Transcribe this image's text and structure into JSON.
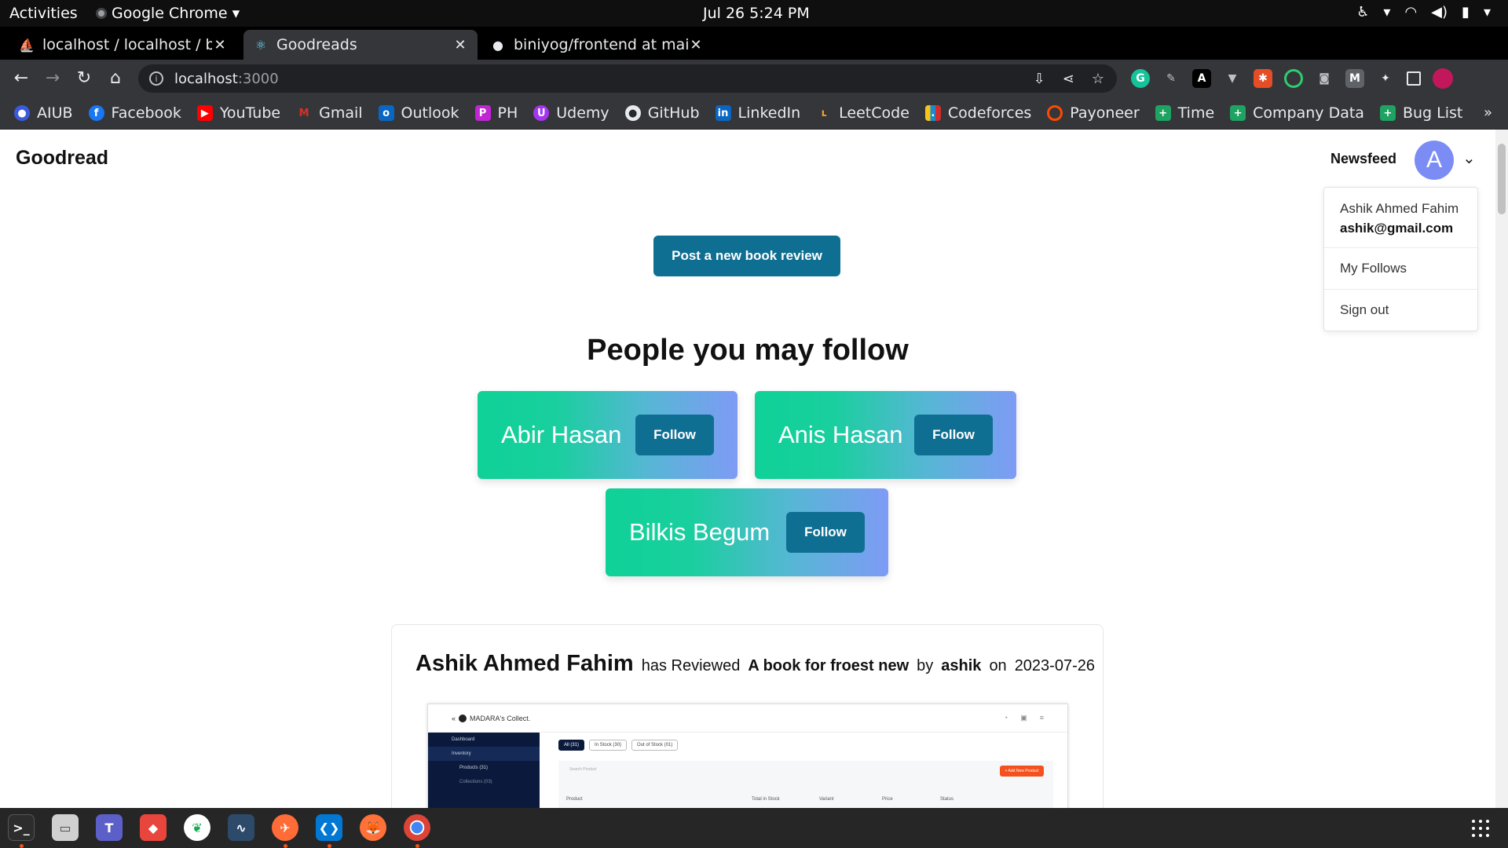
{
  "system": {
    "activities": "Activities",
    "app_name": "Google Chrome",
    "clock": "Jul 26  5:24 PM"
  },
  "browser": {
    "tabs": [
      {
        "title": "localhost / localhost / bini",
        "icon": "phpmyadmin-icon"
      },
      {
        "title": "Goodreads",
        "icon": "react-icon",
        "active": true
      },
      {
        "title": "biniyog/frontend at main",
        "icon": "github-icon"
      }
    ],
    "url": {
      "host": "localhost",
      "port": ":3000"
    },
    "bookmarks": [
      {
        "label": "AIUB",
        "color": "#3b5bdb"
      },
      {
        "label": "Facebook",
        "color": "#1877f2"
      },
      {
        "label": "YouTube",
        "color": "#ff0000"
      },
      {
        "label": "Gmail",
        "color": "#d93025"
      },
      {
        "label": "Outlook",
        "color": "#0a66c2"
      },
      {
        "label": "PH",
        "color": "#c026d3"
      },
      {
        "label": "Udemy",
        "color": "#a435f0"
      },
      {
        "label": "GitHub",
        "color": "#24292f"
      },
      {
        "label": "LinkedIn",
        "color": "#0a66c2"
      },
      {
        "label": "LeetCode",
        "color": "#f0a020"
      },
      {
        "label": "Codeforces",
        "color": "#1f8acb"
      },
      {
        "label": "Payoneer",
        "color": "#ff4800"
      },
      {
        "label": "Time",
        "color": "#1ea362"
      },
      {
        "label": "Company Data",
        "color": "#1ea362"
      },
      {
        "label": "Bug List",
        "color": "#1ea362"
      }
    ]
  },
  "header": {
    "brand": "Goodread",
    "nav_link": "Newsfeed",
    "avatar_letter": "A"
  },
  "dropdown": {
    "name": "Ashik Ahmed Fahim",
    "email": "ashik@gmail.com",
    "items": [
      "My Follows",
      "Sign out"
    ]
  },
  "main": {
    "post_button": "Post a new book review",
    "suggest_title": "People you may follow",
    "follow_label": "Follow",
    "people": [
      "Abir Hasan",
      "Anis Hasan",
      "Bilkis Begum"
    ]
  },
  "review": {
    "reviewer": "Ashik Ahmed Fahim",
    "verb": "has Reviewed",
    "book": "A book for froest new",
    "by": "by",
    "author": "ashik",
    "on": "on",
    "date": "2023-07-26",
    "image": {
      "brand": "MADARA's Collect.",
      "sidebar": [
        "Dashboard",
        "Inventory",
        "Products (31)",
        "Collections (03)"
      ],
      "tabs": [
        "All (31)",
        "In Stock (30)",
        "Out of Stock (01)"
      ],
      "search_placeholder": "Search Product",
      "add_button": "+ Add New Product",
      "columns": [
        "Product",
        "Total in Stock",
        "Variant",
        "Price",
        "Status"
      ]
    }
  },
  "theme": {
    "primary": "#0f6f92",
    "avatar": "#7b8cf5",
    "gradient_start": "#0fd197",
    "gradient_end": "#7e9bf5"
  }
}
